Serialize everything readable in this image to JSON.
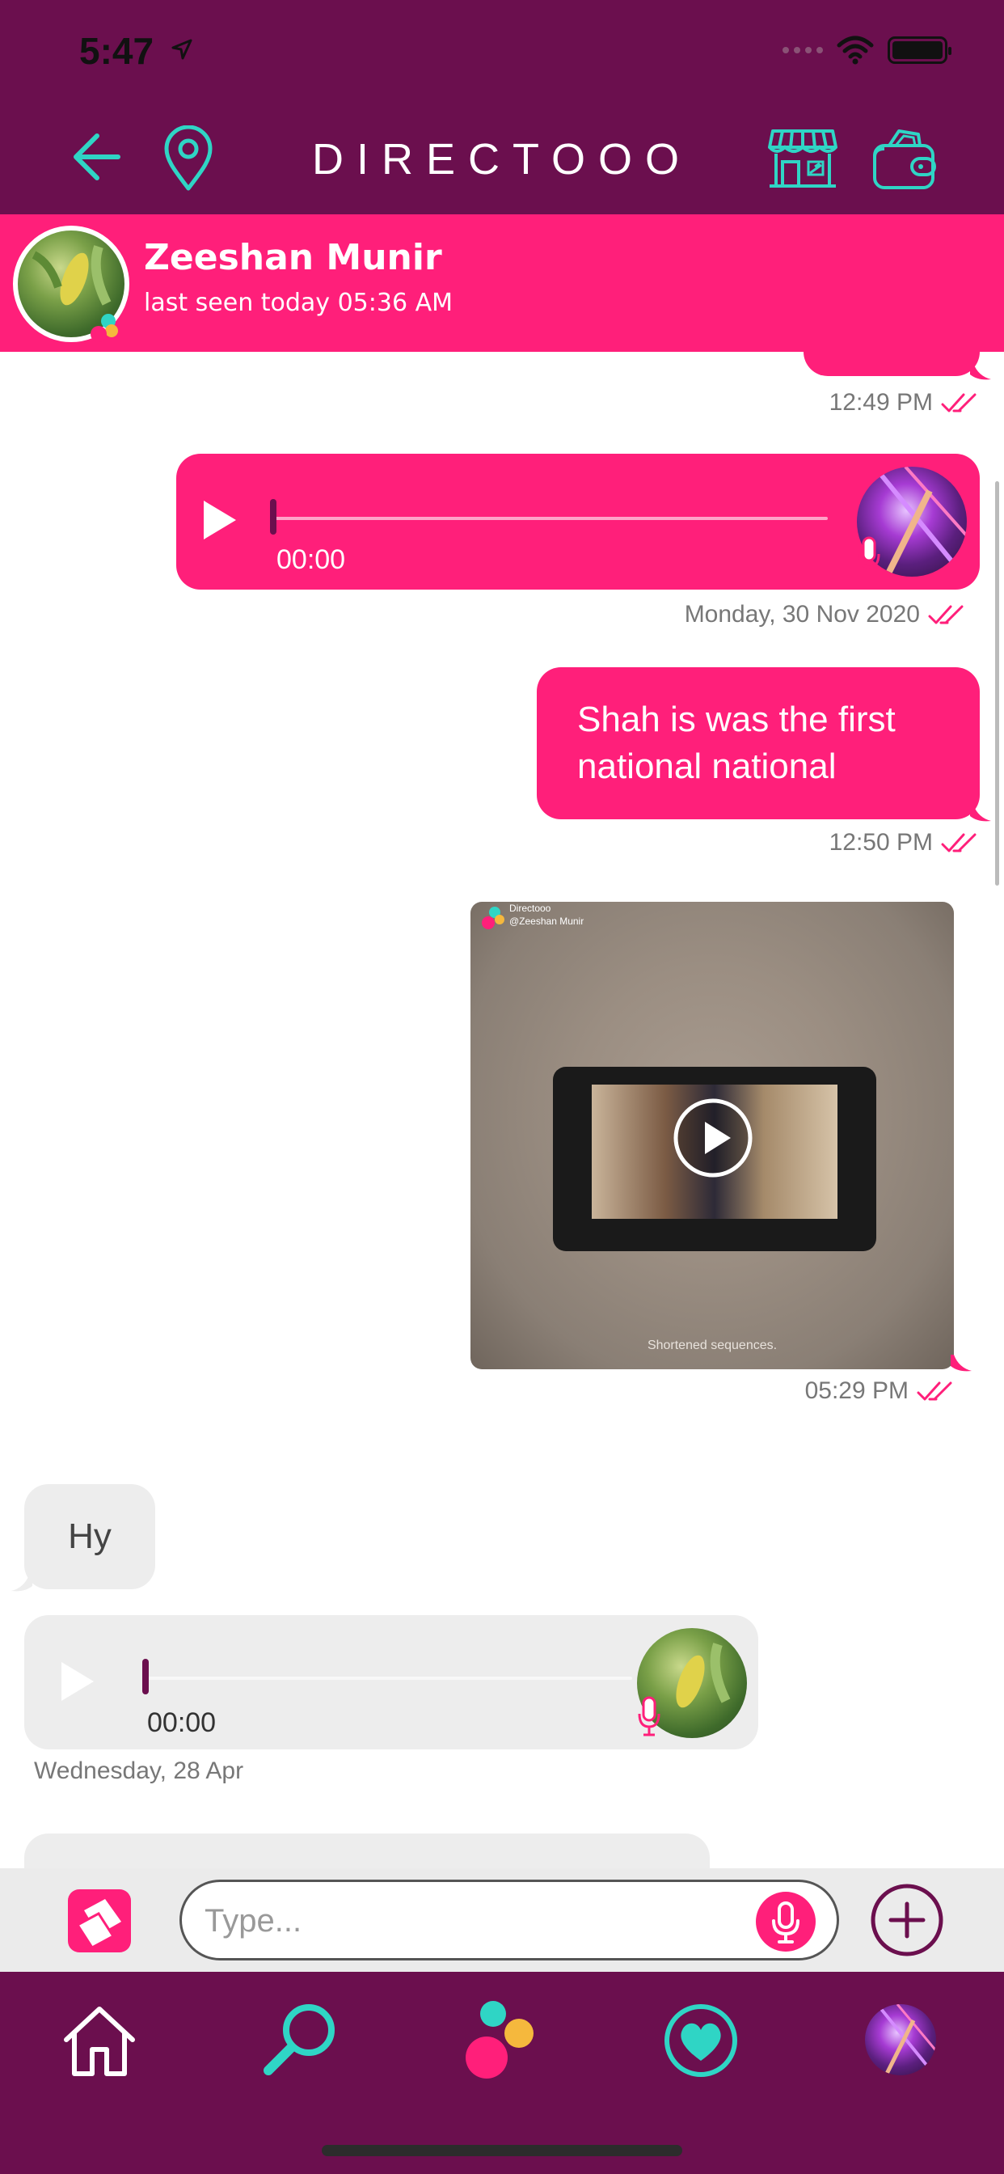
{
  "status_bar": {
    "time": "5:47"
  },
  "header": {
    "brand": "DIRECTOOO"
  },
  "contact": {
    "name": "Zeeshan Munir",
    "last_seen": "last seen today 05:36 AM"
  },
  "messages": {
    "top_partial": {
      "time": "12:49 PM"
    },
    "audio_out": {
      "duration": "00:00",
      "progress": 0,
      "date": "Monday, 30 Nov 2020"
    },
    "text_out": {
      "text": "Shah is was the first national national",
      "time": "12:50 PM"
    },
    "video_out": {
      "brand": "Directooo",
      "handle": "@Zeeshan Munir",
      "caption": "Shortened sequences.",
      "time": "05:29 PM"
    },
    "text_in": {
      "text": "Hy"
    },
    "audio_in": {
      "duration": "00:00",
      "progress": 0,
      "date": "Wednesday, 28 Apr"
    }
  },
  "composer": {
    "placeholder": "Type..."
  },
  "icons": {
    "back": "arrow-left-icon",
    "location": "map-pin-icon",
    "store": "store-icon",
    "wallet": "wallet-icon",
    "sticker": "sticker-icon",
    "mic": "mic-icon",
    "add": "plus-circle-icon",
    "nav": [
      "home-icon",
      "search-icon",
      "directooo-logo-icon",
      "heart-icon",
      "profile-avatar"
    ]
  },
  "colors": {
    "primary": "#6b0f4e",
    "accent": "#ff1f7a",
    "teal": "#2fd5c5"
  }
}
